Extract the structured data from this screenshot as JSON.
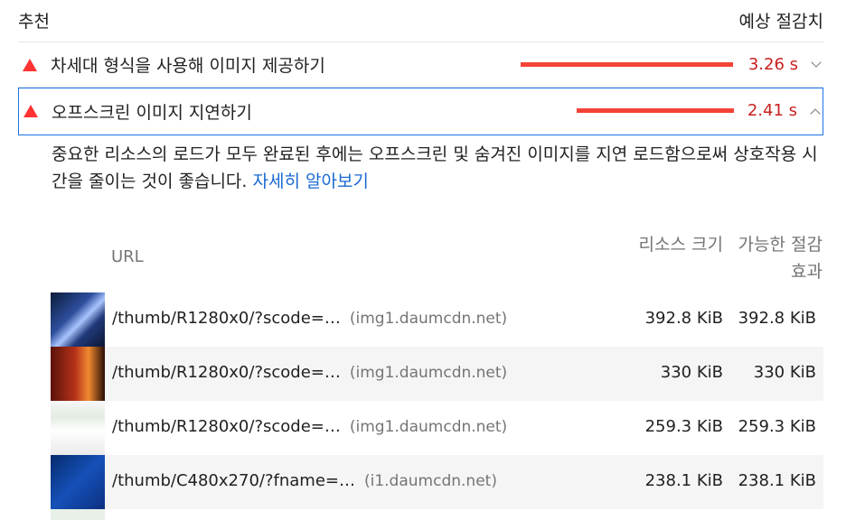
{
  "header": {
    "left": "추천",
    "right": "예상 절감치"
  },
  "audits": [
    {
      "title": "차세대 형식을 사용해 이미지 제공하기",
      "value": "3.26 s",
      "bar_fraction": 1.0
    },
    {
      "title": "오프스크린 이미지 지연하기",
      "value": "2.41 s",
      "bar_fraction": 0.74
    }
  ],
  "description": {
    "text": "중요한 리소스의 로드가 모두 완료된 후에는 오프스크린 및 숨겨진 이미지를 지연 로드함으로써 상호작용 시간을 줄이는 것이 좋습니다.",
    "link": "자세히 알아보기"
  },
  "table": {
    "col_url": "URL",
    "col_size": "리소스 크기",
    "col_save": "가능한 절감 효과",
    "rows": [
      {
        "url": "/thumb/R1280x0/?scode=…",
        "host": "(img1.daumcdn.net)",
        "size": "392.8 KiB",
        "savings": "392.8 KiB"
      },
      {
        "url": "/thumb/R1280x0/?scode=…",
        "host": "(img1.daumcdn.net)",
        "size": "330 KiB",
        "savings": "330 KiB"
      },
      {
        "url": "/thumb/R1280x0/?scode=…",
        "host": "(img1.daumcdn.net)",
        "size": "259.3 KiB",
        "savings": "259.3 KiB"
      },
      {
        "url": "/thumb/C480x270/?fname=…",
        "host": "(i1.daumcdn.net)",
        "size": "238.1 KiB",
        "savings": "238.1 KiB"
      }
    ]
  },
  "colors": {
    "fail": "#ff3333",
    "bar": "#f44336",
    "value": "#c7221f",
    "link": "#1967d2",
    "focus": "#1a73e8"
  }
}
